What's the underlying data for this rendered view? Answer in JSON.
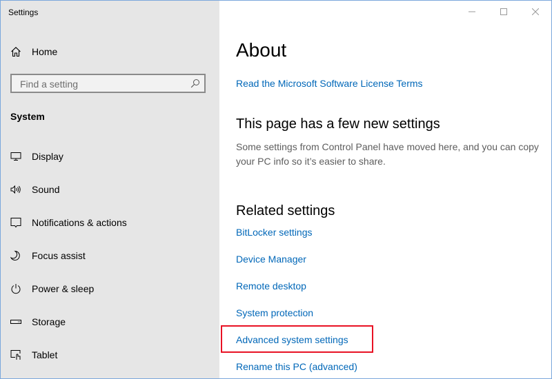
{
  "window": {
    "title": "Settings",
    "caption_buttons": [
      {
        "name": "minimize",
        "icon": "minimize-icon"
      },
      {
        "name": "maximize",
        "icon": "maximize-icon"
      },
      {
        "name": "close",
        "icon": "close-icon"
      }
    ]
  },
  "sidebar": {
    "home": {
      "label": "Home",
      "icon": "home-icon"
    },
    "search": {
      "placeholder": "Find a setting",
      "value": "",
      "icon": "search-icon"
    },
    "section": "System",
    "items": [
      {
        "label": "Display",
        "icon": "display-icon"
      },
      {
        "label": "Sound",
        "icon": "speaker-icon"
      },
      {
        "label": "Notifications & actions",
        "icon": "notification-icon"
      },
      {
        "label": "Focus assist",
        "icon": "moon-icon"
      },
      {
        "label": "Power & sleep",
        "icon": "power-icon"
      },
      {
        "label": "Storage",
        "icon": "storage-icon"
      },
      {
        "label": "Tablet",
        "icon": "tablet-icon"
      }
    ]
  },
  "main": {
    "title": "About",
    "license_link": "Read the Microsoft Software License Terms",
    "new_settings": {
      "heading": "This page has a few new settings",
      "description": "Some settings from Control Panel have moved here, and you can copy your PC info so it’s easier to share."
    },
    "related": {
      "heading": "Related settings",
      "links": [
        "BitLocker settings",
        "Device Manager",
        "Remote desktop",
        "System protection",
        "Advanced system settings",
        "Rename this PC (advanced)"
      ],
      "highlighted_index": 4
    }
  },
  "colors": {
    "link": "#0067b8",
    "sidebar_bg": "#e6e6e6",
    "highlight": "#e81123",
    "window_border": "#7aa7dc"
  }
}
